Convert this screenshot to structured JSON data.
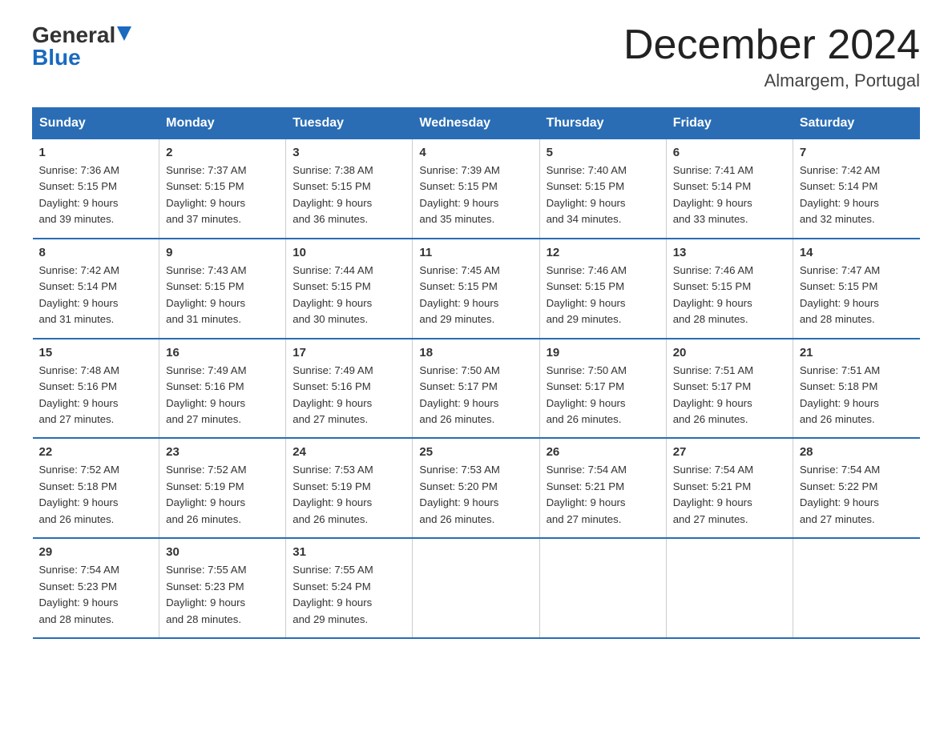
{
  "logo": {
    "general": "General",
    "blue": "Blue"
  },
  "title": "December 2024",
  "location": "Almargem, Portugal",
  "days_header": [
    "Sunday",
    "Monday",
    "Tuesday",
    "Wednesday",
    "Thursday",
    "Friday",
    "Saturday"
  ],
  "weeks": [
    [
      {
        "day": "1",
        "sunrise": "7:36 AM",
        "sunset": "5:15 PM",
        "daylight": "9 hours and 39 minutes."
      },
      {
        "day": "2",
        "sunrise": "7:37 AM",
        "sunset": "5:15 PM",
        "daylight": "9 hours and 37 minutes."
      },
      {
        "day": "3",
        "sunrise": "7:38 AM",
        "sunset": "5:15 PM",
        "daylight": "9 hours and 36 minutes."
      },
      {
        "day": "4",
        "sunrise": "7:39 AM",
        "sunset": "5:15 PM",
        "daylight": "9 hours and 35 minutes."
      },
      {
        "day": "5",
        "sunrise": "7:40 AM",
        "sunset": "5:15 PM",
        "daylight": "9 hours and 34 minutes."
      },
      {
        "day": "6",
        "sunrise": "7:41 AM",
        "sunset": "5:14 PM",
        "daylight": "9 hours and 33 minutes."
      },
      {
        "day": "7",
        "sunrise": "7:42 AM",
        "sunset": "5:14 PM",
        "daylight": "9 hours and 32 minutes."
      }
    ],
    [
      {
        "day": "8",
        "sunrise": "7:42 AM",
        "sunset": "5:14 PM",
        "daylight": "9 hours and 31 minutes."
      },
      {
        "day": "9",
        "sunrise": "7:43 AM",
        "sunset": "5:15 PM",
        "daylight": "9 hours and 31 minutes."
      },
      {
        "day": "10",
        "sunrise": "7:44 AM",
        "sunset": "5:15 PM",
        "daylight": "9 hours and 30 minutes."
      },
      {
        "day": "11",
        "sunrise": "7:45 AM",
        "sunset": "5:15 PM",
        "daylight": "9 hours and 29 minutes."
      },
      {
        "day": "12",
        "sunrise": "7:46 AM",
        "sunset": "5:15 PM",
        "daylight": "9 hours and 29 minutes."
      },
      {
        "day": "13",
        "sunrise": "7:46 AM",
        "sunset": "5:15 PM",
        "daylight": "9 hours and 28 minutes."
      },
      {
        "day": "14",
        "sunrise": "7:47 AM",
        "sunset": "5:15 PM",
        "daylight": "9 hours and 28 minutes."
      }
    ],
    [
      {
        "day": "15",
        "sunrise": "7:48 AM",
        "sunset": "5:16 PM",
        "daylight": "9 hours and 27 minutes."
      },
      {
        "day": "16",
        "sunrise": "7:49 AM",
        "sunset": "5:16 PM",
        "daylight": "9 hours and 27 minutes."
      },
      {
        "day": "17",
        "sunrise": "7:49 AM",
        "sunset": "5:16 PM",
        "daylight": "9 hours and 27 minutes."
      },
      {
        "day": "18",
        "sunrise": "7:50 AM",
        "sunset": "5:17 PM",
        "daylight": "9 hours and 26 minutes."
      },
      {
        "day": "19",
        "sunrise": "7:50 AM",
        "sunset": "5:17 PM",
        "daylight": "9 hours and 26 minutes."
      },
      {
        "day": "20",
        "sunrise": "7:51 AM",
        "sunset": "5:17 PM",
        "daylight": "9 hours and 26 minutes."
      },
      {
        "day": "21",
        "sunrise": "7:51 AM",
        "sunset": "5:18 PM",
        "daylight": "9 hours and 26 minutes."
      }
    ],
    [
      {
        "day": "22",
        "sunrise": "7:52 AM",
        "sunset": "5:18 PM",
        "daylight": "9 hours and 26 minutes."
      },
      {
        "day": "23",
        "sunrise": "7:52 AM",
        "sunset": "5:19 PM",
        "daylight": "9 hours and 26 minutes."
      },
      {
        "day": "24",
        "sunrise": "7:53 AM",
        "sunset": "5:19 PM",
        "daylight": "9 hours and 26 minutes."
      },
      {
        "day": "25",
        "sunrise": "7:53 AM",
        "sunset": "5:20 PM",
        "daylight": "9 hours and 26 minutes."
      },
      {
        "day": "26",
        "sunrise": "7:54 AM",
        "sunset": "5:21 PM",
        "daylight": "9 hours and 27 minutes."
      },
      {
        "day": "27",
        "sunrise": "7:54 AM",
        "sunset": "5:21 PM",
        "daylight": "9 hours and 27 minutes."
      },
      {
        "day": "28",
        "sunrise": "7:54 AM",
        "sunset": "5:22 PM",
        "daylight": "9 hours and 27 minutes."
      }
    ],
    [
      {
        "day": "29",
        "sunrise": "7:54 AM",
        "sunset": "5:23 PM",
        "daylight": "9 hours and 28 minutes."
      },
      {
        "day": "30",
        "sunrise": "7:55 AM",
        "sunset": "5:23 PM",
        "daylight": "9 hours and 28 minutes."
      },
      {
        "day": "31",
        "sunrise": "7:55 AM",
        "sunset": "5:24 PM",
        "daylight": "9 hours and 29 minutes."
      },
      null,
      null,
      null,
      null
    ]
  ]
}
